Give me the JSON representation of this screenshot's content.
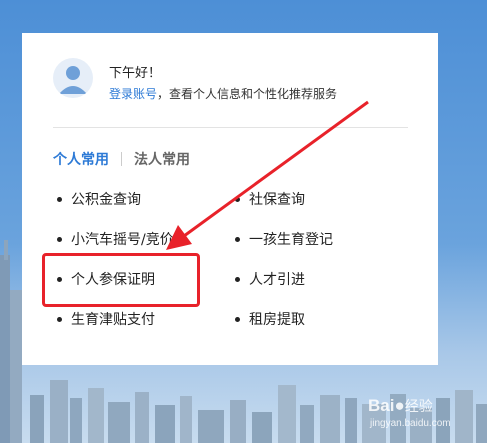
{
  "user": {
    "greeting": "下午好！",
    "login_link": "登录账号",
    "login_hint": "，查看个人信息和个性化推荐服务"
  },
  "tabs": [
    {
      "label": "个人常用",
      "active": true
    },
    {
      "label": "法人常用",
      "active": false
    }
  ],
  "services": {
    "left": [
      "公积金查询",
      "小汽车摇号/竞价",
      "个人参保证明",
      "生育津贴支付"
    ],
    "right": [
      "社保查询",
      "一孩生育登记",
      "人才引进",
      "租房提取"
    ]
  },
  "highlighted_item": "个人参保证明",
  "colors": {
    "accent": "#2d7ad6",
    "annotation": "#e8222a",
    "background": "#4d8fd6"
  },
  "watermark": {
    "brand": "Bai",
    "suffix": "经验",
    "url": "jingyan.baidu.com"
  }
}
